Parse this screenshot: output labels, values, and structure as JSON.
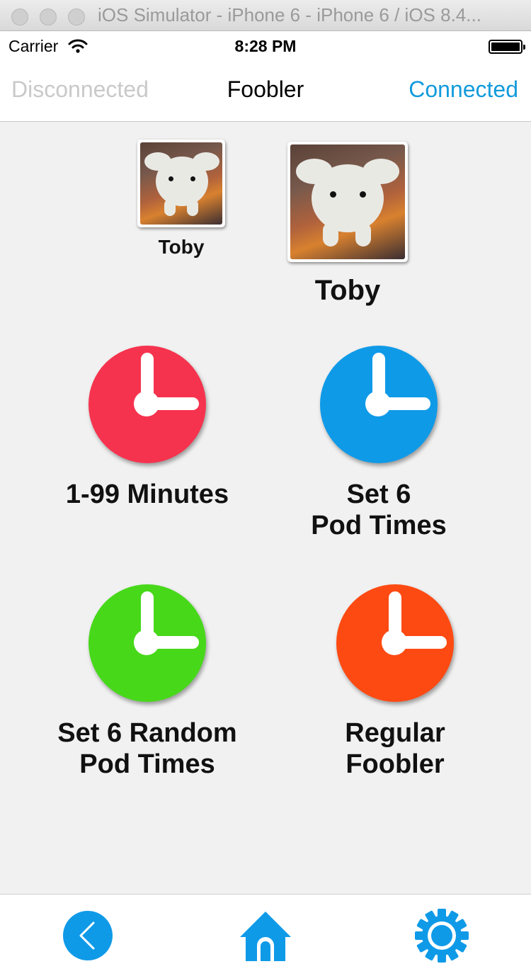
{
  "window": {
    "title": "iOS Simulator - iPhone 6 - iPhone 6 / iOS 8.4..."
  },
  "status_bar": {
    "carrier": "Carrier",
    "time": "8:28 PM"
  },
  "nav": {
    "left": "Disconnected",
    "title": "Foobler",
    "right": "Connected"
  },
  "profiles": [
    {
      "name": "Toby"
    },
    {
      "name": "Toby"
    }
  ],
  "tiles": [
    {
      "label": "1-99 Minutes",
      "color": "#f6334e"
    },
    {
      "label": "Set 6\nPod Times",
      "color": "#0f9ae8"
    },
    {
      "label": "Set 6 Random\nPod Times",
      "color": "#47d81a"
    },
    {
      "label": "Regular\nFoobler",
      "color": "#fd4a12"
    }
  ],
  "tab_bar": {
    "icons": [
      "back-icon",
      "home-icon",
      "settings-gear-icon"
    ],
    "accent": "#0f9ae8"
  }
}
